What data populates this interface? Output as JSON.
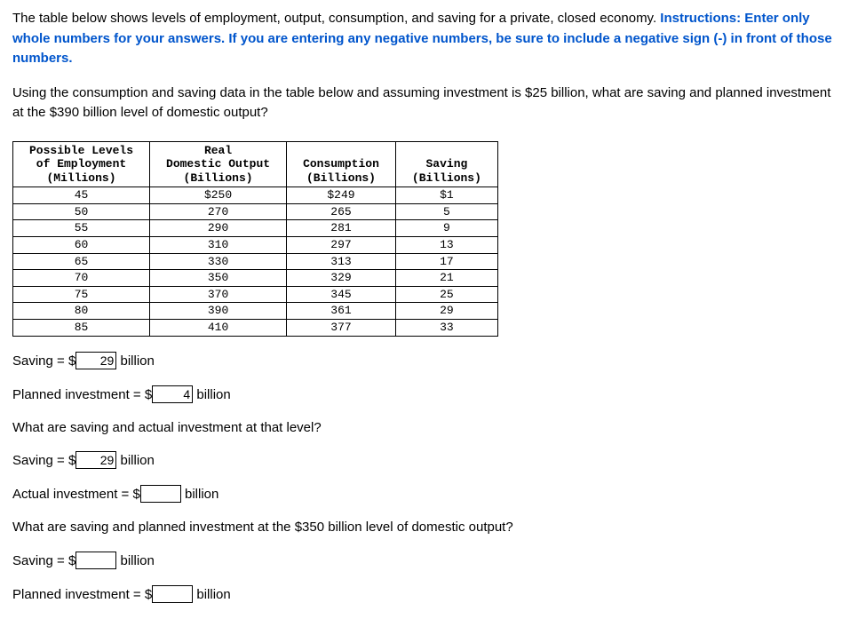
{
  "intro_plain": "The table below shows levels of employment, output, consumption, and saving for a private, closed economy. ",
  "intro_bold": "Instructions: Enter only whole numbers for your answers. If you are entering any negative numbers, be sure to include a negative sign (-) in front of those numbers.",
  "question1": "Using the consumption and saving data in the table below and assuming investment is $25 billion, what are saving and planned investment at the $390 billion level of domestic output?",
  "chart_data": {
    "type": "table",
    "headers": [
      "Possible Levels of Employment (Millions)",
      "Real Domestic Output (Billions)",
      "Consumption (Billions)",
      "Saving (Billions)"
    ],
    "rows": [
      [
        "45",
        "$250",
        "$249",
        "$1"
      ],
      [
        "50",
        "270",
        "265",
        "5"
      ],
      [
        "55",
        "290",
        "281",
        "9"
      ],
      [
        "60",
        "310",
        "297",
        "13"
      ],
      [
        "65",
        "330",
        "313",
        "17"
      ],
      [
        "70",
        "350",
        "329",
        "21"
      ],
      [
        "75",
        "370",
        "345",
        "25"
      ],
      [
        "80",
        "390",
        "361",
        "29"
      ],
      [
        "85",
        "410",
        "377",
        "33"
      ]
    ]
  },
  "th": {
    "c0a": "Possible Levels",
    "c0b": "of Employment",
    "c0c": "(Millions)",
    "c1a": "Real",
    "c1b": "Domestic Output",
    "c1c": "(Billions)",
    "c2a": "Consumption",
    "c2b": "(Billions)",
    "c3a": "Saving",
    "c3b": "(Billions)"
  },
  "lines": {
    "saving_prefix": "Saving = $",
    "billion": " billion",
    "planned_prefix": "Planned investment = $",
    "actual_prefix": "Actual investment = $"
  },
  "values": {
    "saving1": "29",
    "planned1": "4",
    "saving2": "29",
    "actual2": "",
    "saving3": "",
    "planned3": ""
  },
  "subq2": "What are saving and actual investment at that level?",
  "subq3": "What are saving and planned investment at the $350 billion level of domestic output?"
}
